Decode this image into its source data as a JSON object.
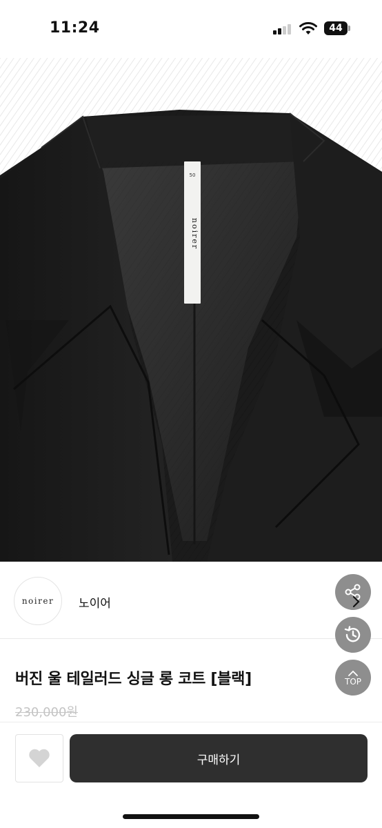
{
  "status_bar": {
    "time": "11:24",
    "battery": "44"
  },
  "product_image": {
    "tag_size": "50",
    "tag_brand": "noirer"
  },
  "seller": {
    "logo_text": "noirer",
    "name": "노이어"
  },
  "floating": {
    "top_label": "TOP",
    "icons": [
      "share-icon",
      "history-icon",
      "arrow-up-icon"
    ]
  },
  "product": {
    "title": "버진 울 테일러드 싱글 롱 코트 [블랙]",
    "price": "230,000원"
  },
  "bottom_bar": {
    "buy_label": "구매하기",
    "like_icon": "heart-icon"
  },
  "colors": {
    "buy_button": "#2f2f2f",
    "fab": "#8e8e8e",
    "price_strike": "#c4c4c4"
  }
}
